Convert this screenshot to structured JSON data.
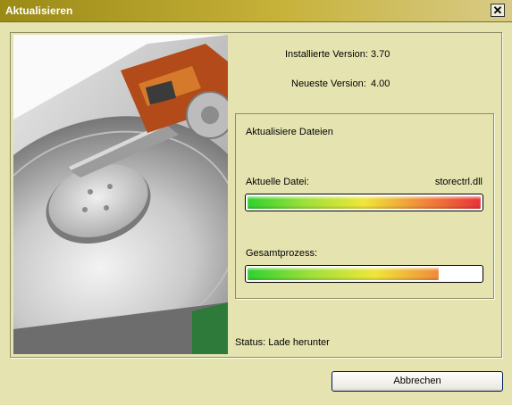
{
  "window": {
    "title": "Aktualisieren",
    "close_symbol": "✕"
  },
  "versions": {
    "installed_label": "Installierte Version:",
    "installed_value": "3.70",
    "newest_label": "Neueste Version:",
    "newest_value": "4.00"
  },
  "update_group": {
    "heading": "Aktualisiere Dateien",
    "current_file_label": "Aktuelle Datei:",
    "current_file_name": "storectrl.dll",
    "current_file_progress": 1.0,
    "total_label": "Gesamtprozess:",
    "total_progress": 0.82
  },
  "status": {
    "text": "Status: Lade herunter"
  },
  "buttons": {
    "cancel_label": "Abbrechen"
  },
  "colors": {
    "progress_gradient": [
      "#2fd12f",
      "#9fe03a",
      "#f0e63a",
      "#f08a3a",
      "#e8323a"
    ]
  }
}
